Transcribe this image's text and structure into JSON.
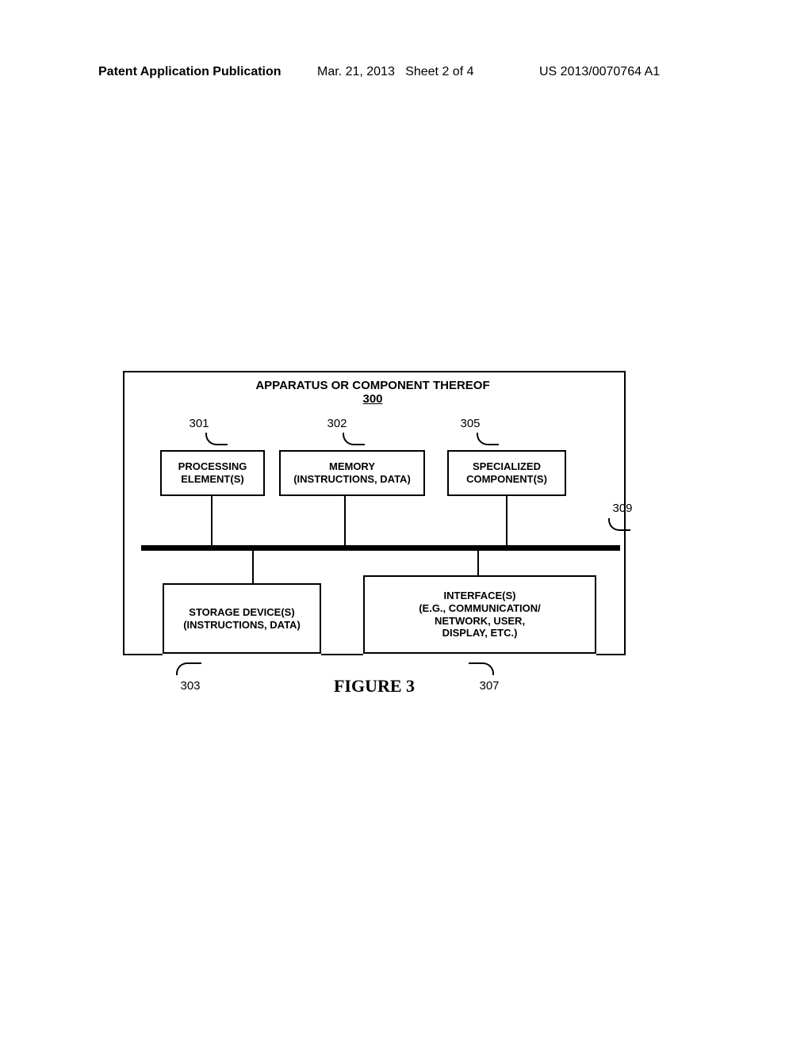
{
  "header": {
    "left": "Patent Application Publication",
    "date": "Mar. 21, 2013",
    "sheet": "Sheet 2 of 4",
    "docnum": "US 2013/0070764 A1"
  },
  "diagram": {
    "title": "APPARATUS OR COMPONENT THEREOF",
    "title_ref": "300",
    "boxes": {
      "processing": {
        "ref": "301",
        "line1": "PROCESSING",
        "line2": "ELEMENT(S)"
      },
      "memory": {
        "ref": "302",
        "line1": "MEMORY",
        "line2": "(INSTRUCTIONS, DATA)"
      },
      "specialized": {
        "ref": "305",
        "line1": "SPECIALIZED",
        "line2": "COMPONENT(S)"
      },
      "storage": {
        "ref": "303",
        "line1": "STORAGE DEVICE(S)",
        "line2": "(INSTRUCTIONS, DATA)"
      },
      "interfaces": {
        "ref": "307",
        "line1": "INTERFACE(S)",
        "line2": "(E.G., COMMUNICATION/",
        "line3": "NETWORK, USER,",
        "line4": "DISPLAY, ETC.)"
      }
    },
    "bus_ref": "309",
    "caption": "FIGURE 3"
  }
}
